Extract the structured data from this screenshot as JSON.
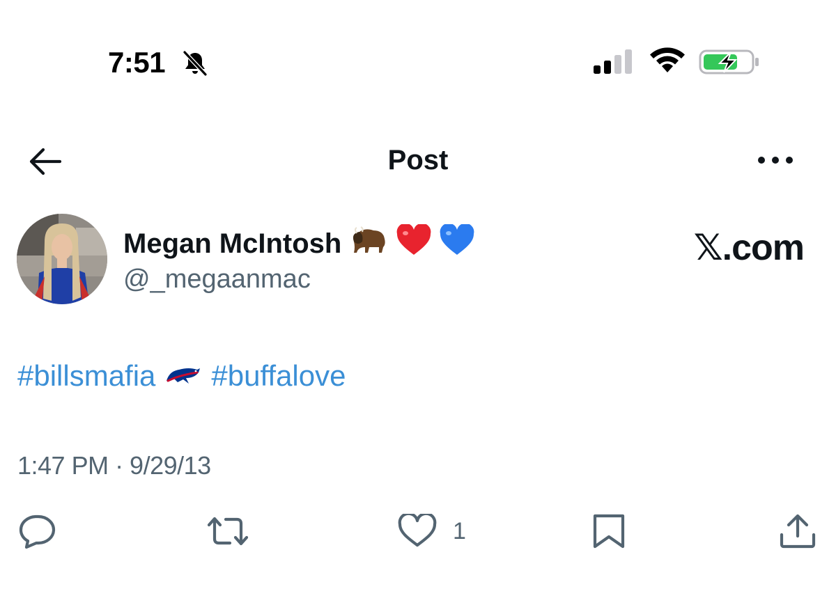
{
  "status_bar": {
    "time": "7:51",
    "silent_icon": "bell-slash-icon",
    "signal_icon": "cellular-signal-icon",
    "wifi_icon": "wifi-icon",
    "battery_icon": "battery-charging-icon",
    "battery_color": "#34c759"
  },
  "nav": {
    "back_icon": "arrow-left-icon",
    "title": "Post",
    "more_icon": "ellipsis-icon"
  },
  "author": {
    "name": "Megan McIntosh",
    "name_emojis": [
      "🦬",
      "❤️",
      "💙"
    ],
    "handle": "@_megaanmac",
    "avatar_icon": "profile-photo"
  },
  "watermark": "𝕏.com",
  "tweet": {
    "hashtag_1": "#billsmafia",
    "logo_icon": "buffalo-bills-logo",
    "hashtag_2": "#buffalove",
    "link_color": "#3b8fd6",
    "timestamp": "1:47 PM · 9/29/13"
  },
  "actions": {
    "reply_icon": "reply-icon",
    "repost_icon": "repost-icon",
    "like_icon": "heart-icon",
    "like_count": "1",
    "bookmark_icon": "bookmark-icon",
    "share_icon": "share-icon",
    "icon_color": "#536471"
  }
}
